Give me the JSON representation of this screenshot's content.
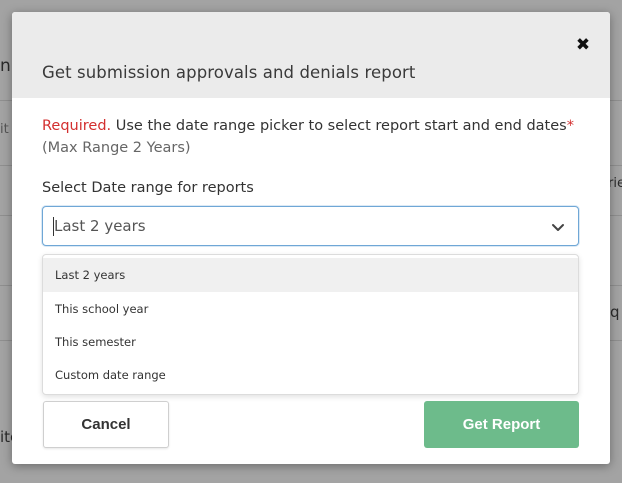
{
  "background": {
    "fragments": [
      "n",
      "it",
      "rie",
      "q",
      "ite"
    ]
  },
  "modal": {
    "title": "Get submission approvals and denials report",
    "close_glyph": "✖",
    "required_label": "Required.",
    "required_text": " Use the date range picker to select report start and end dates",
    "required_star": "*",
    "max_range": "(Max Range 2 Years)",
    "field_label": "Select Date range for reports",
    "select_value": "Last 2 years",
    "options": [
      "Last 2 years",
      "This school year",
      "This semester",
      "Custom date range"
    ],
    "cancel_label": "Cancel",
    "submit_label": "Get Report"
  },
  "colors": {
    "required": "#d32f2f",
    "submit_button": "#6dbb8b",
    "select_focus_border": "#6fa7d6",
    "header_bg": "#ebebeb"
  },
  "icons": {
    "close": "close-icon",
    "dropdown": "chevron-down-icon"
  }
}
